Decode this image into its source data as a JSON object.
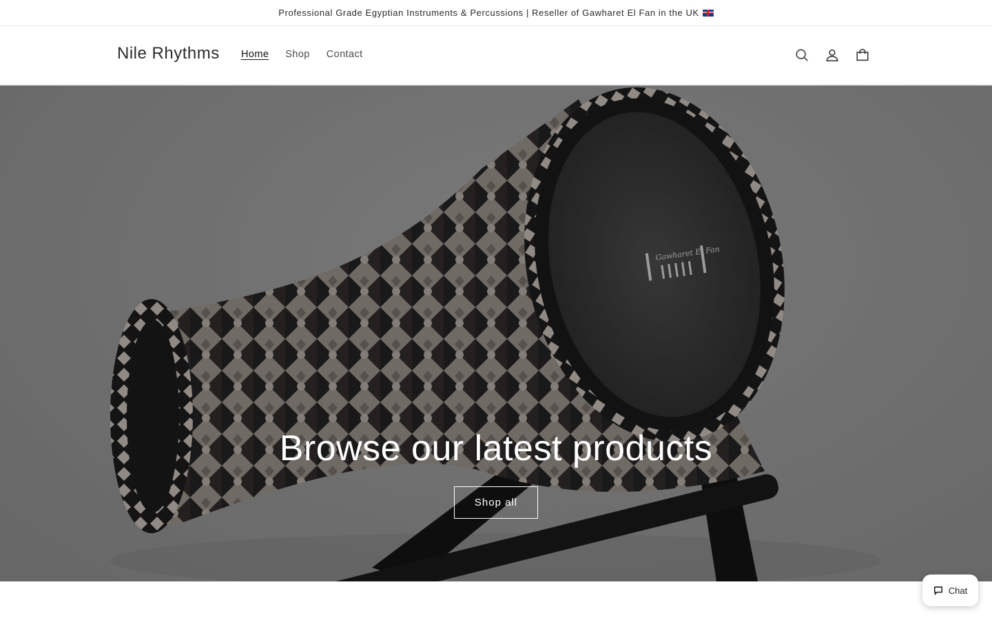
{
  "announcement": {
    "text": "Professional Grade Egyptian Instruments & Percussions | Reseller of Gawharet El Fan in the UK"
  },
  "header": {
    "logo": "Nile Rhythms",
    "nav": [
      {
        "label": "Home",
        "active": true
      },
      {
        "label": "Shop",
        "active": false
      },
      {
        "label": "Contact",
        "active": false
      }
    ],
    "icons": [
      "search-icon",
      "account-icon",
      "cart-icon"
    ]
  },
  "hero": {
    "title": "Browse our latest products",
    "button_label": "Shop all",
    "drum_head_text": "Gawharet El Fan"
  },
  "chat": {
    "label": "Chat"
  },
  "colors": {
    "text": "#121212",
    "border": "#e6e6e6",
    "hero_text": "#ffffff"
  }
}
